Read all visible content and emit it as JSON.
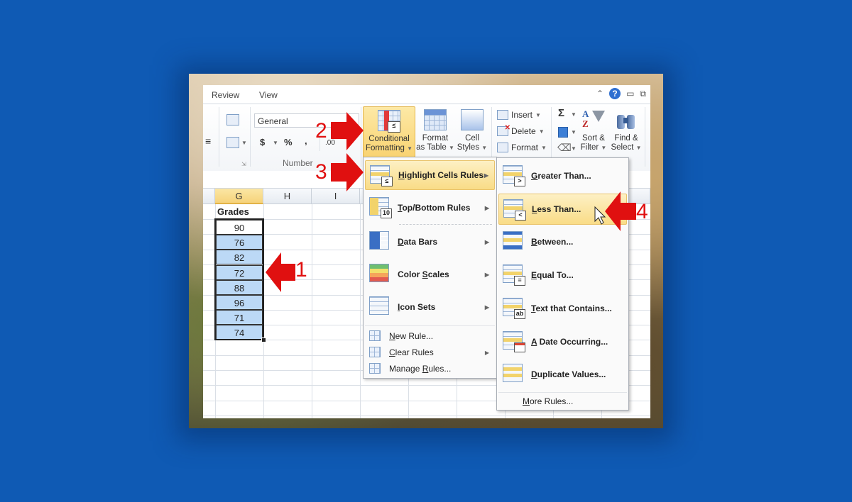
{
  "ribbon_tabs": [
    {
      "label": "Review"
    },
    {
      "label": "View"
    }
  ],
  "window_controls": {
    "minimize_ribbon": "^",
    "help": "?",
    "minimize": "▭",
    "restore": "⧉"
  },
  "ribbon": {
    "number_format_value": "General",
    "currency_symbol": "$",
    "percent_symbol": "%",
    "comma_symbol": ",",
    "increase_decimal": ".00",
    "number_group_label": "Number",
    "conditional_formatting": {
      "line1": "Conditional",
      "line2": "Formatting"
    },
    "format_as_table": {
      "line1": "Format",
      "line2": "as Table"
    },
    "cell_styles": {
      "line1": "Cell",
      "line2": "Styles"
    },
    "insert_label": "Insert",
    "delete_label": "Delete",
    "format_label": "Format",
    "autosum_symbol": "Σ",
    "sort_filter": {
      "line1": "Sort &",
      "line2": "Filter"
    },
    "find_select": {
      "line1": "Find &",
      "line2": "Select"
    }
  },
  "sheet": {
    "columns": [
      "G",
      "H",
      "I"
    ],
    "selected_column": "G",
    "header_cell": "Grades",
    "grades": [
      "90",
      "76",
      "82",
      "72",
      "88",
      "96",
      "71",
      "74"
    ]
  },
  "cf_menu": {
    "items": [
      {
        "label": "Highlight Cells Rules",
        "underline": "H",
        "rest": "ighlight Cells Rules",
        "icon": "highlight-cells-icon",
        "submenu": true,
        "highlighted": true
      },
      {
        "label": "Top/Bottom Rules",
        "underline": "T",
        "rest": "op/Bottom Rules",
        "icon": "top-bottom-icon",
        "submenu": true
      },
      {
        "label": "Data Bars",
        "underline": "D",
        "rest": "ata Bars",
        "icon": "data-bars-icon",
        "submenu": true
      },
      {
        "label": "Color Scales",
        "pre": "Color ",
        "underline": "S",
        "rest": "cales",
        "icon": "color-scales-icon",
        "submenu": true
      },
      {
        "label": "Icon Sets",
        "underline": "I",
        "rest": "con Sets",
        "icon": "icon-sets-icon",
        "submenu": true
      }
    ],
    "small_items": [
      {
        "label": "New Rule...",
        "underline": "N",
        "rest": "ew Rule...",
        "submenu": false
      },
      {
        "label": "Clear Rules",
        "underline": "C",
        "rest": "lear Rules",
        "submenu": true
      },
      {
        "label": "Manage Rules...",
        "pre": "Manage ",
        "underline": "R",
        "rest": "ules...",
        "submenu": false
      }
    ]
  },
  "hcr_submenu": {
    "items": [
      {
        "label": "Greater Than...",
        "underline": "G",
        "rest": "reater Than...",
        "badge": ">"
      },
      {
        "label": "Less Than...",
        "underline": "L",
        "rest": "ess Than...",
        "badge": "<",
        "highlighted": true
      },
      {
        "label": "Between...",
        "underline": "B",
        "rest": "etween...",
        "badge": ""
      },
      {
        "label": "Equal To...",
        "underline": "E",
        "rest": "qual To...",
        "badge": "="
      },
      {
        "label": "Text that Contains...",
        "underline": "T",
        "rest": "ext that Contains...",
        "badge": "ab"
      },
      {
        "label": "A Date Occurring...",
        "underline": "A",
        "rest": " Date Occurring...",
        "badge": "cal"
      },
      {
        "label": "Duplicate Values...",
        "underline": "D",
        "rest": "uplicate Values...",
        "badge": ""
      }
    ],
    "more_rules": {
      "underline": "M",
      "rest": "ore Rules..."
    }
  },
  "annotations": [
    {
      "step": "1",
      "target": "selected grades range"
    },
    {
      "step": "2",
      "target": "Conditional Formatting button"
    },
    {
      "step": "3",
      "target": "Highlight Cells Rules"
    },
    {
      "step": "4",
      "target": "Less Than..."
    }
  ],
  "colors": {
    "background": "#0f5ab4",
    "selection_fill": "#bcd9f6",
    "menu_highlight": "#f9dc87",
    "annotation_red": "#e01010"
  }
}
